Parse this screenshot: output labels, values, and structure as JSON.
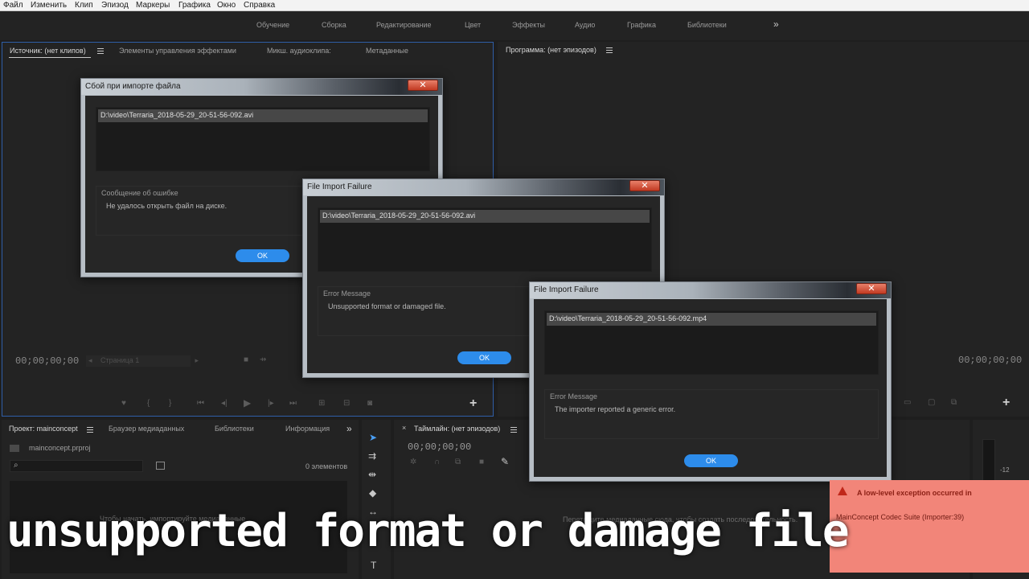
{
  "menubar": [
    "Файл",
    "Изменить",
    "Клип",
    "Эпизод",
    "Маркеры",
    "Графика",
    "Окно",
    "Справка"
  ],
  "workspaces": [
    "Обучение",
    "Сборка",
    "Редактирование",
    "Цвет",
    "Эффекты",
    "Аудио",
    "Графика",
    "Библиотеки"
  ],
  "workspace_more": "»",
  "source_panel": {
    "tabs": [
      "Источник: (нет клипов)",
      "Элементы управления эффектами",
      "Микш. аудиоклипа:",
      "Метаданные"
    ],
    "timecode": "00;00;00;00",
    "page_select": "Страница 1"
  },
  "program_panel": {
    "title": "Программа: (нет эпизодов)",
    "timecode": "00;00;00;00"
  },
  "project_panel": {
    "tabs": [
      "Проект: mainconcept",
      "Браузер медиаданных",
      "Библиотеки",
      "Информация"
    ],
    "more": "»",
    "project_file": "mainconcept.prproj",
    "item_count": "0 элементов",
    "empty_hint": "Чтобы начать, импортируйте медиаданные"
  },
  "timeline_panel": {
    "title": "Таймлайн: (нет эпизодов)",
    "close": "×",
    "timecode": "00;00;00;00",
    "empty_hint": "Перетащите медиаданные сюда, чтобы создать последовательность."
  },
  "meter_label": "-12",
  "dialogs": [
    {
      "title": "Сбой при импорте файла",
      "file": "D:\\video\\Terraria_2018-05-29_20-51-56-092.avi",
      "error_label": "Сообщение об ошибке",
      "error_message": "Не удалось открыть файл на диске.",
      "ok": "OK",
      "close": "✕"
    },
    {
      "title": "File Import Failure",
      "file": "D:\\video\\Terraria_2018-05-29_20-51-56-092.avi",
      "error_label": "Error Message",
      "error_message": "Unsupported format or damaged file.",
      "ok": "OK",
      "close": "✕"
    },
    {
      "title": "File Import Failure",
      "file": "D:\\video\\Terraria_2018-05-29_20-51-56-092.mp4",
      "error_label": "Error Message",
      "error_message": "The importer reported a generic error.",
      "ok": "OK",
      "close": "✕"
    }
  ],
  "toast": {
    "title": "A low-level exception occurred in",
    "body": "MainConcept Codec Suite (Importer:39)"
  },
  "caption": "unsupported format or damage file",
  "colors": {
    "accent": "#2d8ceb",
    "toast": "#f28579",
    "panel": "#232323",
    "background": "#1e1e1e"
  }
}
